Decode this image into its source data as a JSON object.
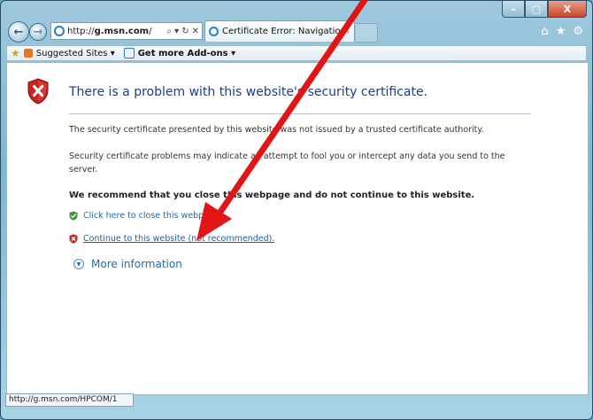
{
  "window": {
    "caption_minimize": "–",
    "caption_maximize": "□",
    "caption_close": "X"
  },
  "nav": {
    "back_glyph": "←",
    "forward_glyph": "→",
    "url_prefix": "http://",
    "url_host": "g.msn.com",
    "url_suffix": "/",
    "search_glyph": "⌕ ▾",
    "refresh_glyph": "↻",
    "stop_glyph": "✕",
    "tab_title": "Certificate Error: Navigation...",
    "tab_close": "✕",
    "tools_home": "⌂",
    "tools_favorites": "★",
    "tools_settings": "⚙"
  },
  "favbar": {
    "suggested_sites": "Suggested Sites ▾",
    "get_more_addons": "Get more Add-ons ▾"
  },
  "content": {
    "title": "There is a problem with this website's security certificate.",
    "paragraph1": "The security certificate presented by this website was not issued by a trusted certificate authority.",
    "paragraph2": "Security certificate problems may indicate an attempt to fool you or intercept any data you send to the server.",
    "recommendation": "We recommend that you close this webpage and do not continue to this website.",
    "close_link": "Click here to close this webpage.",
    "continue_link": "Continue to this website (not recommended).",
    "more_information": "More information"
  },
  "status": {
    "url": "http://g.msn.com/HPCOM/1"
  },
  "colors": {
    "title_blue": "#1f3d88",
    "link_blue": "#1a6fb0",
    "arrow_red": "#e01515",
    "shield_red": "#c8231c",
    "shield_green": "#3a9a3a"
  }
}
